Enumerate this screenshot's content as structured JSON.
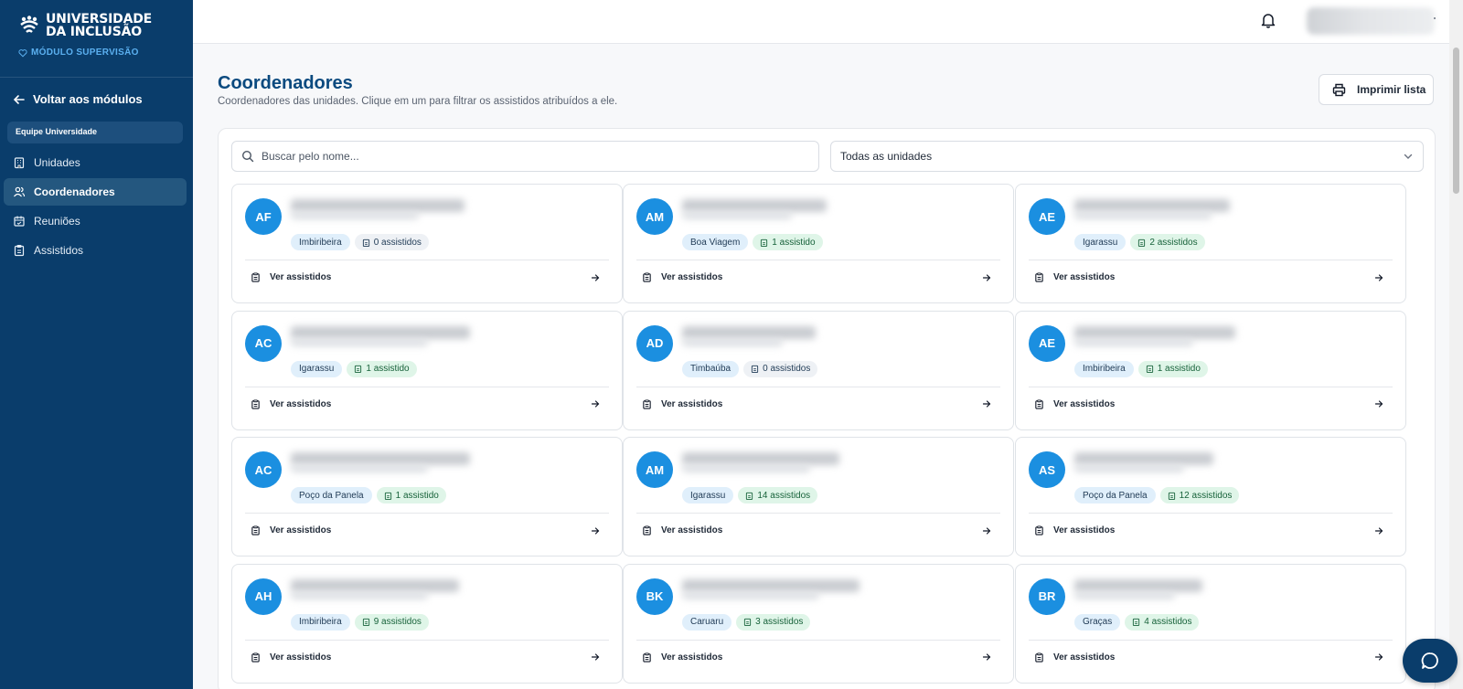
{
  "brand": {
    "line1": "UNIVERSIDADE",
    "line2": "DA INCLUSÃO",
    "module": "MÓDULO SUPERVISÃO"
  },
  "sidebar": {
    "back_label": "Voltar aos módulos",
    "team_label": "Equipe Universidade",
    "items": [
      {
        "label": "Unidades",
        "icon": "building-icon",
        "active": false
      },
      {
        "label": "Coordenadores",
        "icon": "users-icon",
        "active": true
      },
      {
        "label": "Reuniões",
        "icon": "calendar-icon",
        "active": false
      },
      {
        "label": "Assistidos",
        "icon": "clipboard-icon",
        "active": false
      }
    ]
  },
  "header": {
    "title": "Coordenadores",
    "subtitle": "Coordenadores das unidades. Clique em um para filtrar os assistidos atribuídos a ele.",
    "print_label": "Imprimir lista"
  },
  "filters": {
    "search_placeholder": "Buscar pelo nome...",
    "unit_select_value": "Todas as unidades"
  },
  "cards": [
    {
      "initials": "AF",
      "unit": "Imbiribeira",
      "count": "0 assistidos",
      "zero": true,
      "action": "Ver assistidos"
    },
    {
      "initials": "AM",
      "unit": "Boa Viagem",
      "count": "1 assistido",
      "zero": false,
      "action": "Ver assistidos"
    },
    {
      "initials": "AE",
      "unit": "Igarassu",
      "count": "2 assistidos",
      "zero": false,
      "action": "Ver assistidos"
    },
    {
      "initials": "AC",
      "unit": "Igarassu",
      "count": "1 assistido",
      "zero": false,
      "action": "Ver assistidos"
    },
    {
      "initials": "AD",
      "unit": "Timbaúba",
      "count": "0 assistidos",
      "zero": true,
      "action": "Ver assistidos"
    },
    {
      "initials": "AE",
      "unit": "Imbiribeira",
      "count": "1 assistido",
      "zero": false,
      "action": "Ver assistidos"
    },
    {
      "initials": "AC",
      "unit": "Poço da Panela",
      "count": "1 assistido",
      "zero": false,
      "action": "Ver assistidos"
    },
    {
      "initials": "AM",
      "unit": "Igarassu",
      "count": "14 assistidos",
      "zero": false,
      "action": "Ver assistidos"
    },
    {
      "initials": "AS",
      "unit": "Poço da Panela",
      "count": "12 assistidos",
      "zero": false,
      "action": "Ver assistidos"
    },
    {
      "initials": "AH",
      "unit": "Imbiribeira",
      "count": "9 assistidos",
      "zero": false,
      "action": "Ver assistidos"
    },
    {
      "initials": "BK",
      "unit": "Caruaru",
      "count": "3 assistidos",
      "zero": false,
      "action": "Ver assistidos"
    },
    {
      "initials": "BR",
      "unit": "Graças",
      "count": "4 assistidos",
      "zero": false,
      "action": "Ver assistidos"
    }
  ],
  "colors": {
    "sidebar_bg": "#0a3d6b",
    "accent": "#1b8fe0",
    "title": "#0b4a7f",
    "badge_green": "#dff5e8"
  }
}
